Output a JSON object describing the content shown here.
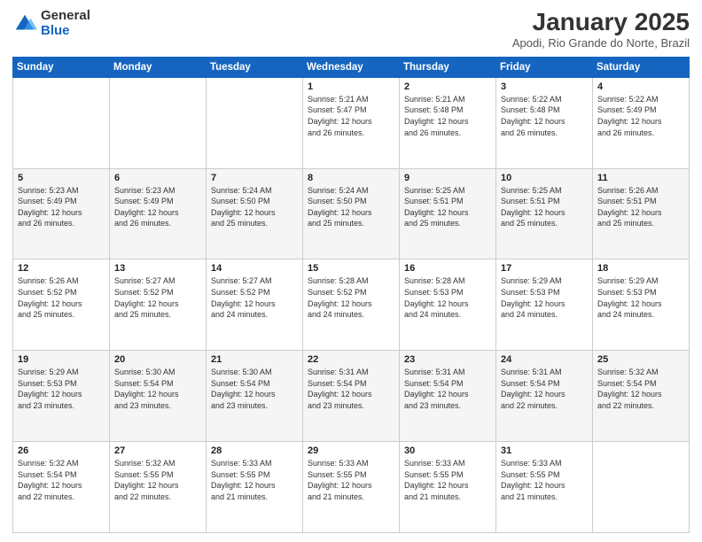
{
  "logo": {
    "general": "General",
    "blue": "Blue"
  },
  "header": {
    "title": "January 2025",
    "subtitle": "Apodi, Rio Grande do Norte, Brazil"
  },
  "days_of_week": [
    "Sunday",
    "Monday",
    "Tuesday",
    "Wednesday",
    "Thursday",
    "Friday",
    "Saturday"
  ],
  "weeks": [
    [
      {
        "day": "",
        "info": ""
      },
      {
        "day": "",
        "info": ""
      },
      {
        "day": "",
        "info": ""
      },
      {
        "day": "1",
        "info": "Sunrise: 5:21 AM\nSunset: 5:47 PM\nDaylight: 12 hours\nand 26 minutes."
      },
      {
        "day": "2",
        "info": "Sunrise: 5:21 AM\nSunset: 5:48 PM\nDaylight: 12 hours\nand 26 minutes."
      },
      {
        "day": "3",
        "info": "Sunrise: 5:22 AM\nSunset: 5:48 PM\nDaylight: 12 hours\nand 26 minutes."
      },
      {
        "day": "4",
        "info": "Sunrise: 5:22 AM\nSunset: 5:49 PM\nDaylight: 12 hours\nand 26 minutes."
      }
    ],
    [
      {
        "day": "5",
        "info": "Sunrise: 5:23 AM\nSunset: 5:49 PM\nDaylight: 12 hours\nand 26 minutes."
      },
      {
        "day": "6",
        "info": "Sunrise: 5:23 AM\nSunset: 5:49 PM\nDaylight: 12 hours\nand 26 minutes."
      },
      {
        "day": "7",
        "info": "Sunrise: 5:24 AM\nSunset: 5:50 PM\nDaylight: 12 hours\nand 25 minutes."
      },
      {
        "day": "8",
        "info": "Sunrise: 5:24 AM\nSunset: 5:50 PM\nDaylight: 12 hours\nand 25 minutes."
      },
      {
        "day": "9",
        "info": "Sunrise: 5:25 AM\nSunset: 5:51 PM\nDaylight: 12 hours\nand 25 minutes."
      },
      {
        "day": "10",
        "info": "Sunrise: 5:25 AM\nSunset: 5:51 PM\nDaylight: 12 hours\nand 25 minutes."
      },
      {
        "day": "11",
        "info": "Sunrise: 5:26 AM\nSunset: 5:51 PM\nDaylight: 12 hours\nand 25 minutes."
      }
    ],
    [
      {
        "day": "12",
        "info": "Sunrise: 5:26 AM\nSunset: 5:52 PM\nDaylight: 12 hours\nand 25 minutes."
      },
      {
        "day": "13",
        "info": "Sunrise: 5:27 AM\nSunset: 5:52 PM\nDaylight: 12 hours\nand 25 minutes."
      },
      {
        "day": "14",
        "info": "Sunrise: 5:27 AM\nSunset: 5:52 PM\nDaylight: 12 hours\nand 24 minutes."
      },
      {
        "day": "15",
        "info": "Sunrise: 5:28 AM\nSunset: 5:52 PM\nDaylight: 12 hours\nand 24 minutes."
      },
      {
        "day": "16",
        "info": "Sunrise: 5:28 AM\nSunset: 5:53 PM\nDaylight: 12 hours\nand 24 minutes."
      },
      {
        "day": "17",
        "info": "Sunrise: 5:29 AM\nSunset: 5:53 PM\nDaylight: 12 hours\nand 24 minutes."
      },
      {
        "day": "18",
        "info": "Sunrise: 5:29 AM\nSunset: 5:53 PM\nDaylight: 12 hours\nand 24 minutes."
      }
    ],
    [
      {
        "day": "19",
        "info": "Sunrise: 5:29 AM\nSunset: 5:53 PM\nDaylight: 12 hours\nand 23 minutes."
      },
      {
        "day": "20",
        "info": "Sunrise: 5:30 AM\nSunset: 5:54 PM\nDaylight: 12 hours\nand 23 minutes."
      },
      {
        "day": "21",
        "info": "Sunrise: 5:30 AM\nSunset: 5:54 PM\nDaylight: 12 hours\nand 23 minutes."
      },
      {
        "day": "22",
        "info": "Sunrise: 5:31 AM\nSunset: 5:54 PM\nDaylight: 12 hours\nand 23 minutes."
      },
      {
        "day": "23",
        "info": "Sunrise: 5:31 AM\nSunset: 5:54 PM\nDaylight: 12 hours\nand 23 minutes."
      },
      {
        "day": "24",
        "info": "Sunrise: 5:31 AM\nSunset: 5:54 PM\nDaylight: 12 hours\nand 22 minutes."
      },
      {
        "day": "25",
        "info": "Sunrise: 5:32 AM\nSunset: 5:54 PM\nDaylight: 12 hours\nand 22 minutes."
      }
    ],
    [
      {
        "day": "26",
        "info": "Sunrise: 5:32 AM\nSunset: 5:54 PM\nDaylight: 12 hours\nand 22 minutes."
      },
      {
        "day": "27",
        "info": "Sunrise: 5:32 AM\nSunset: 5:55 PM\nDaylight: 12 hours\nand 22 minutes."
      },
      {
        "day": "28",
        "info": "Sunrise: 5:33 AM\nSunset: 5:55 PM\nDaylight: 12 hours\nand 21 minutes."
      },
      {
        "day": "29",
        "info": "Sunrise: 5:33 AM\nSunset: 5:55 PM\nDaylight: 12 hours\nand 21 minutes."
      },
      {
        "day": "30",
        "info": "Sunrise: 5:33 AM\nSunset: 5:55 PM\nDaylight: 12 hours\nand 21 minutes."
      },
      {
        "day": "31",
        "info": "Sunrise: 5:33 AM\nSunset: 5:55 PM\nDaylight: 12 hours\nand 21 minutes."
      },
      {
        "day": "",
        "info": ""
      }
    ]
  ]
}
